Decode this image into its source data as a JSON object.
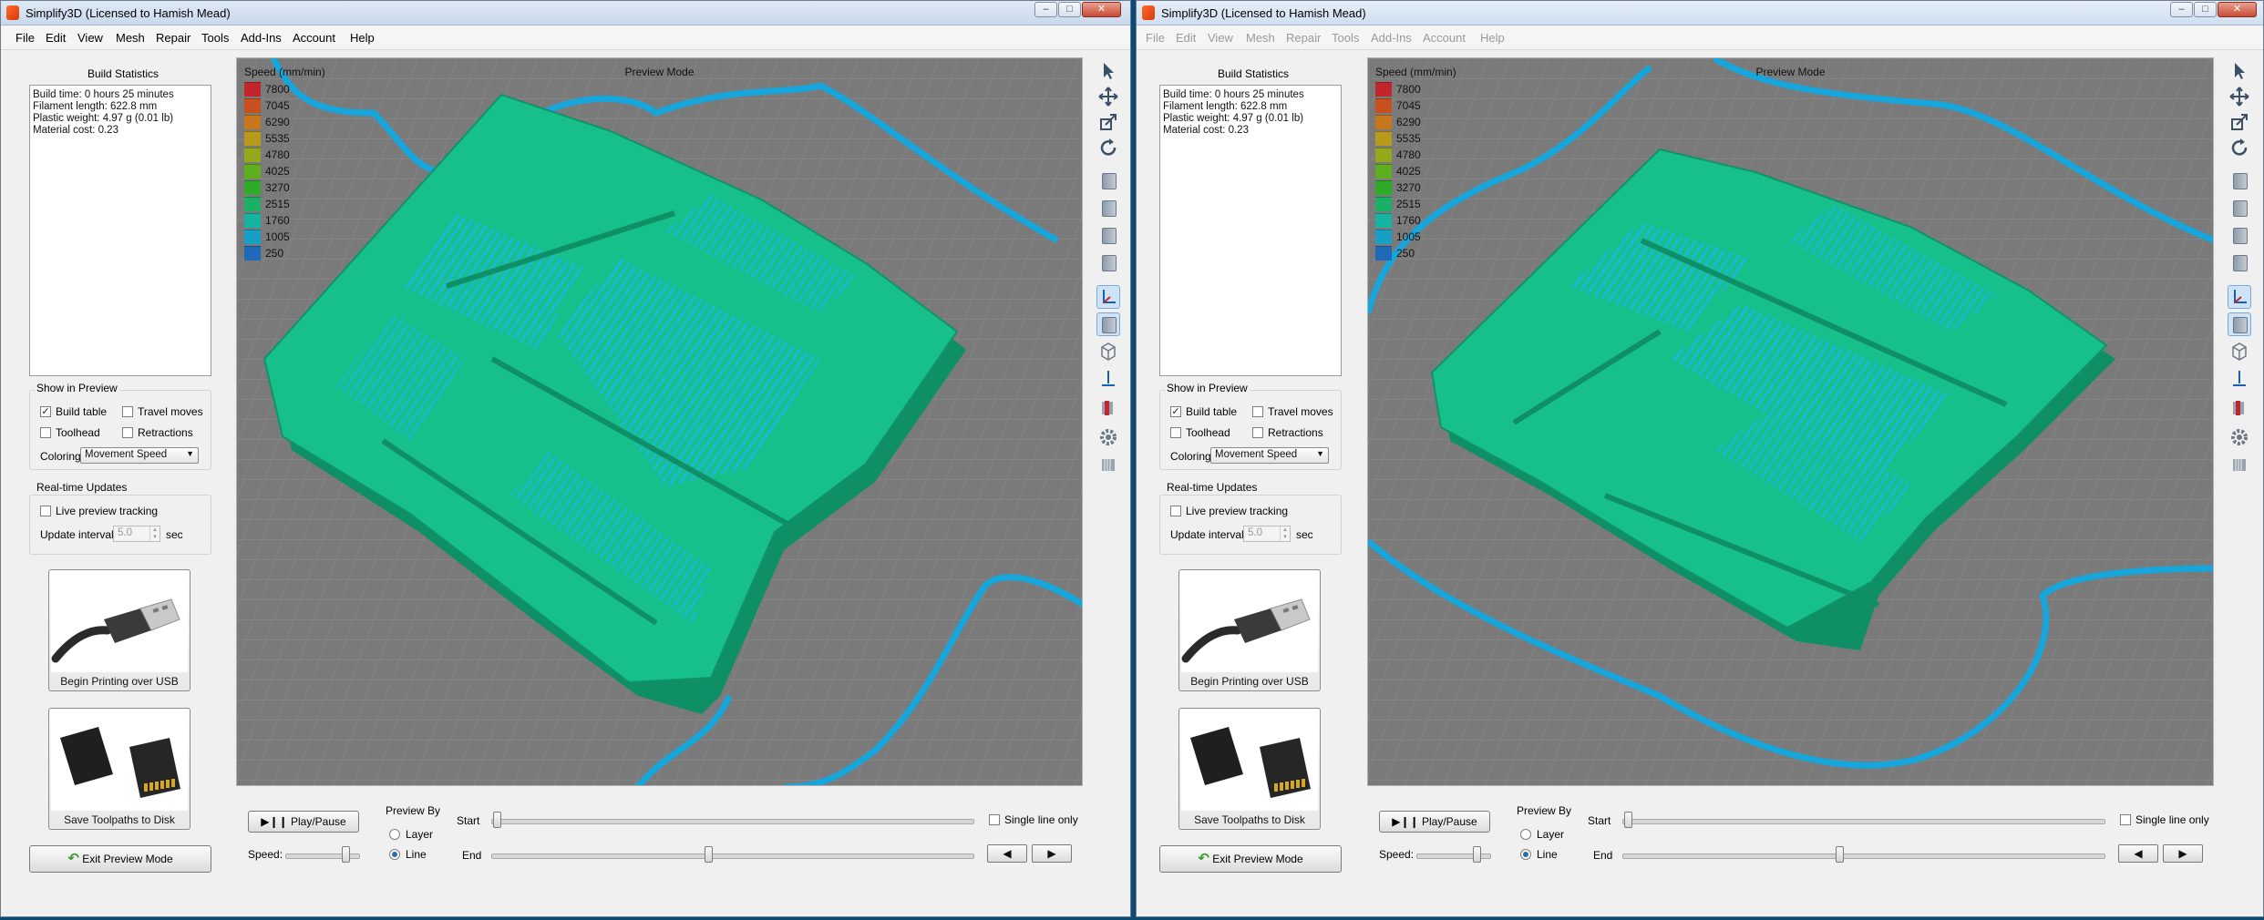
{
  "windows": [
    {
      "title": "Simplify3D (Licensed to Hamish Mead)",
      "menu": [
        "File",
        "Edit",
        "View",
        "Mesh",
        "Repair",
        "Tools",
        "Add-Ins",
        "Account",
        "Help"
      ],
      "build_statistics": {
        "heading": "Build Statistics",
        "lines": [
          "Build time: 0 hours 25 minutes",
          "Filament length: 622.8 mm",
          "Plastic weight: 4.97 g (0.01 lb)",
          "Material cost: 0.23"
        ]
      },
      "show_in_preview": {
        "heading": "Show in Preview",
        "build_table": "Build table",
        "travel_moves": "Travel moves",
        "toolhead": "Toolhead",
        "retractions": "Retractions",
        "coloring_label": "Coloring",
        "coloring_value": "Movement Speed"
      },
      "realtime": {
        "heading": "Real-time Updates",
        "live_tracking": "Live preview tracking",
        "interval_label": "Update interval",
        "interval_value": "5.0",
        "interval_unit": "sec"
      },
      "usb_card_label": "Begin Printing over USB",
      "disk_card_label": "Save Toolpaths to Disk",
      "exit_label": "Exit Preview Mode",
      "viewport_title": "Preview Mode",
      "legend_title": "Speed (mm/min)",
      "legend": [
        {
          "value": "7800",
          "color": "#c0262b"
        },
        {
          "value": "7045",
          "color": "#c8501e"
        },
        {
          "value": "6290",
          "color": "#c6771c"
        },
        {
          "value": "5535",
          "color": "#b89a1a"
        },
        {
          "value": "4780",
          "color": "#94a81b"
        },
        {
          "value": "4025",
          "color": "#5fae1f"
        },
        {
          "value": "3270",
          "color": "#2fab2a"
        },
        {
          "value": "2515",
          "color": "#1cb066"
        },
        {
          "value": "1760",
          "color": "#16b4a0"
        },
        {
          "value": "1005",
          "color": "#179fc6"
        },
        {
          "value": "250",
          "color": "#1f69b8"
        }
      ],
      "controls": {
        "play_label": "Play/Pause",
        "speed_label": "Speed:",
        "preview_by": "Preview By",
        "layer": "Layer",
        "line": "Line",
        "start_label": "Start",
        "end_label": "End",
        "single_line": "Single line only",
        "prev": "◀",
        "next": "▶"
      }
    },
    {
      "title": "Simplify3D (Licensed to Hamish Mead)",
      "menu": [
        "File",
        "Edit",
        "View",
        "Mesh",
        "Repair",
        "Tools",
        "Add-Ins",
        "Account",
        "Help"
      ],
      "build_statistics": {
        "heading": "Build Statistics",
        "lines": [
          "Build time: 0 hours 25 minutes",
          "Filament length: 622.8 mm",
          "Plastic weight: 4.97 g (0.01 lb)",
          "Material cost: 0.23"
        ]
      },
      "show_in_preview": {
        "heading": "Show in Preview",
        "build_table": "Build table",
        "travel_moves": "Travel moves",
        "toolhead": "Toolhead",
        "retractions": "Retractions",
        "coloring_label": "Coloring",
        "coloring_value": "Movement Speed"
      },
      "realtime": {
        "heading": "Real-time Updates",
        "live_tracking": "Live preview tracking",
        "interval_label": "Update interval",
        "interval_value": "5.0",
        "interval_unit": "sec"
      },
      "usb_card_label": "Begin Printing over USB",
      "disk_card_label": "Save Toolpaths to Disk",
      "exit_label": "Exit Preview Mode",
      "viewport_title": "Preview Mode",
      "legend_title": "Speed (mm/min)",
      "legend": [
        {
          "value": "7800",
          "color": "#c0262b"
        },
        {
          "value": "7045",
          "color": "#c8501e"
        },
        {
          "value": "6290",
          "color": "#c6771c"
        },
        {
          "value": "5535",
          "color": "#b89a1a"
        },
        {
          "value": "4780",
          "color": "#94a81b"
        },
        {
          "value": "4025",
          "color": "#5fae1f"
        },
        {
          "value": "3270",
          "color": "#2fab2a"
        },
        {
          "value": "2515",
          "color": "#1cb066"
        },
        {
          "value": "1760",
          "color": "#16b4a0"
        },
        {
          "value": "1005",
          "color": "#179fc6"
        },
        {
          "value": "250",
          "color": "#1f69b8"
        }
      ],
      "controls": {
        "play_label": "Play/Pause",
        "speed_label": "Speed:",
        "preview_by": "Preview By",
        "layer": "Layer",
        "line": "Line",
        "start_label": "Start",
        "end_label": "End",
        "single_line": "Single line only",
        "prev": "◀",
        "next": "▶"
      }
    }
  ],
  "state": {
    "build_table_checked": true,
    "travel_moves_checked": false,
    "toolhead_checked": false,
    "retractions_checked": false,
    "live_tracking_checked": false,
    "single_line_checked": false,
    "preview_by_selected": "Line",
    "speed_slider_fraction": 0.85,
    "start_slider_fraction": 0.0,
    "end_slider_fraction": 0.45
  },
  "icons": {
    "select_tool": "cursor-arrow-icon",
    "move_tool": "move-arrows-icon",
    "scale_tool": "scale-icon",
    "rotate_tool": "rotate-icon",
    "views": [
      "view-iso-icon",
      "view-front-icon",
      "view-top-icon",
      "view-side-icon"
    ],
    "axes": "axes-icon",
    "solid": "solid-view-icon",
    "wireframe": "wireframe-icon",
    "normals": "normals-icon",
    "clip": "clip-icon",
    "settings": "gear-icon",
    "layers": "layers-icon"
  },
  "colors": {
    "print": "#17c08a",
    "print_edge": "#0f8f66",
    "infill": "#1ab7d6",
    "travel": "#1aa9dc",
    "grid_bg": "#7d7d7d"
  }
}
